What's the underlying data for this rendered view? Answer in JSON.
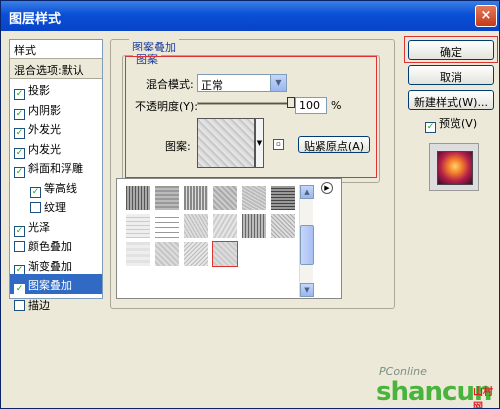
{
  "window": {
    "title": "图层样式",
    "close": "×"
  },
  "left_panel": {
    "header": "样式",
    "blend_options": "混合选项:默认",
    "items": [
      {
        "label": "投影",
        "checked": true,
        "sub": false,
        "selected": false
      },
      {
        "label": "内阴影",
        "checked": true,
        "sub": false,
        "selected": false
      },
      {
        "label": "外发光",
        "checked": true,
        "sub": false,
        "selected": false
      },
      {
        "label": "内发光",
        "checked": true,
        "sub": false,
        "selected": false
      },
      {
        "label": "斜面和浮雕",
        "checked": true,
        "sub": false,
        "selected": false
      },
      {
        "label": "等高线",
        "checked": true,
        "sub": true,
        "selected": false
      },
      {
        "label": "纹理",
        "checked": false,
        "sub": true,
        "selected": false
      },
      {
        "label": "光泽",
        "checked": true,
        "sub": false,
        "selected": false
      },
      {
        "label": "颜色叠加",
        "checked": false,
        "sub": false,
        "selected": false
      },
      {
        "label": "渐变叠加",
        "checked": true,
        "sub": false,
        "selected": false
      },
      {
        "label": "图案叠加",
        "checked": true,
        "sub": false,
        "selected": true
      },
      {
        "label": "描边",
        "checked": false,
        "sub": false,
        "selected": false
      }
    ]
  },
  "pattern_overlay": {
    "group_title": "图案叠加",
    "inner_title": "图案",
    "blend_mode_label": "混合模式:",
    "blend_mode_value": "正常",
    "opacity_label": "不透明度(Y):",
    "opacity_value": "100",
    "opacity_unit": "%",
    "opacity_fraction": 1.0,
    "pattern_label": "图案:",
    "snap_origin_button": "贴紧原点(A)"
  },
  "pattern_picker": {
    "selected_index": 15,
    "count": 16
  },
  "right_panel": {
    "ok": "确定",
    "cancel": "取消",
    "new_style": "新建样式(W)...",
    "preview_label": "预览(V)",
    "preview_checked": true
  },
  "watermark": {
    "line1": "PConline",
    "line2": "shancun",
    "line3": "山村网"
  },
  "colors": {
    "selection": "#316ac5",
    "title_bar": "#0a4fd6",
    "highlight_red": "#dd3333"
  }
}
